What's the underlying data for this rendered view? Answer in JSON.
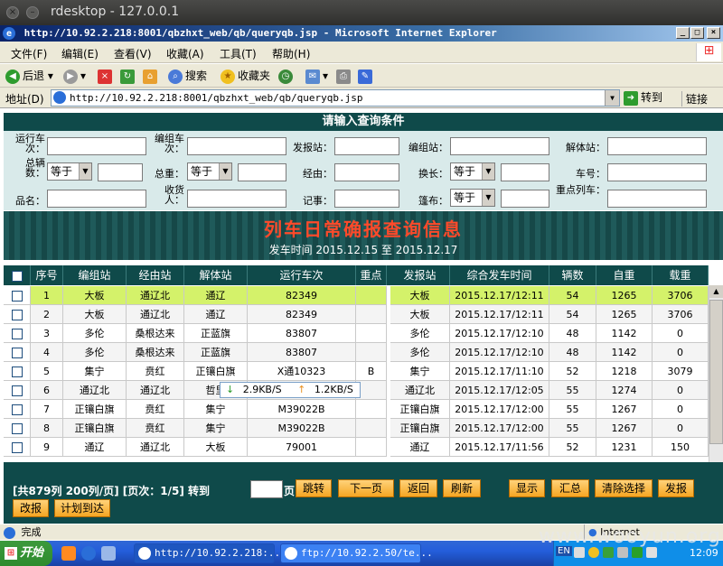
{
  "rdesktop": {
    "title": "rdesktop - 127.0.0.1"
  },
  "window": {
    "title": "http://10.92.2.218:8001/qbzhxt_web/qb/queryqb.jsp - Microsoft Internet Explorer",
    "min": "_",
    "max": "□",
    "close": "×"
  },
  "menu": [
    "文件(F)",
    "编辑(E)",
    "查看(V)",
    "收藏(A)",
    "工具(T)",
    "帮助(H)"
  ],
  "toolbar": {
    "back": "后退",
    "search": "搜索",
    "favorites": "收藏夹"
  },
  "address": {
    "label": "地址(D)",
    "url": "http://10.92.2.218:8001/qbzhxt_web/qb/queryqb.jsp",
    "go": "转到",
    "links": "链接"
  },
  "query": {
    "title": "请输入查询条件",
    "labels": {
      "yxcc": "运行车次：",
      "bzcc": "编组车次：",
      "fbz": "发报站：",
      "bzz": "编组站：",
      "jtz": "解体站：",
      "zls": "总辆数：",
      "zz": "总重：",
      "jy": "经由：",
      "hc": "换长：",
      "ch": "车号：",
      "pm": "品名：",
      "shr": "收货人：",
      "js": "记事：",
      "pb": "篷布：",
      "zdlc": "重点列车："
    },
    "op_eq": "等于"
  },
  "banner": {
    "title": "列车日常确报查询信息",
    "date": "发车时间  2015.12.15 至 2015.12.17"
  },
  "table": {
    "headers": [
      "序号",
      "编组站",
      "经由站",
      "解体站",
      "运行车次",
      "重点",
      "发报站",
      "综合发车时间",
      "辆数",
      "自重",
      "载重"
    ],
    "rows": [
      [
        "1",
        "大板",
        "通辽北",
        "通辽",
        "82349",
        "",
        "大板",
        "2015.12.17/12:11",
        "54",
        "1265",
        "3706"
      ],
      [
        "2",
        "大板",
        "通辽北",
        "通辽",
        "82349",
        "",
        "大板",
        "2015.12.17/12:11",
        "54",
        "1265",
        "3706"
      ],
      [
        "3",
        "多伦",
        "桑根达来",
        "正蓝旗",
        "83807",
        "",
        "多伦",
        "2015.12.17/12:10",
        "48",
        "1142",
        "0"
      ],
      [
        "4",
        "多伦",
        "桑根达来",
        "正蓝旗",
        "83807",
        "",
        "多伦",
        "2015.12.17/12:10",
        "48",
        "1142",
        "0"
      ],
      [
        "5",
        "集宁",
        "贲红",
        "正镶白旗",
        "X通10323",
        "B",
        "集宁",
        "2015.12.17/11:10",
        "52",
        "1218",
        "3079"
      ],
      [
        "6",
        "通辽北",
        "通辽北",
        "哲里",
        "",
        "",
        "通辽北",
        "2015.12.17/12:05",
        "55",
        "1274",
        "0"
      ],
      [
        "7",
        "正镶白旗",
        "贲红",
        "集宁",
        "M39022B",
        "",
        "正镶白旗",
        "2015.12.17/12:00",
        "55",
        "1267",
        "0"
      ],
      [
        "8",
        "正镶白旗",
        "贲红",
        "集宁",
        "M39022B",
        "",
        "正镶白旗",
        "2015.12.17/12:00",
        "55",
        "1267",
        "0"
      ],
      [
        "9",
        "通辽",
        "通辽北",
        "大板",
        "79001",
        "",
        "通辽",
        "2015.12.17/11:56",
        "52",
        "1231",
        "150"
      ]
    ]
  },
  "netspeed": {
    "down": "2.9KB/S",
    "up": "1.2KB/S"
  },
  "footer": {
    "info": "[共879列  200列/页]  [页次：1/5]  转到",
    "page_suffix": "页",
    "buttons": [
      "跳转",
      "下一页",
      "返回",
      "刷新",
      "显示",
      "汇总",
      "清除选择",
      "发报",
      "改报",
      "计划到达"
    ]
  },
  "status": {
    "text": "完成",
    "zone": "Internet"
  },
  "taskbar": {
    "start": "开始",
    "tasks": [
      "http://10.92.2.218:...",
      "ftp://10.92.2.50/te..."
    ],
    "lang": "EN",
    "time": "12:09"
  },
  "watermark": "www.wooyun.org",
  "colors": {
    "header_bg": "#0f4a4a",
    "selected_row": "#d4f26a",
    "button": "#f5a623",
    "banner_title": "#ff4a2a"
  }
}
